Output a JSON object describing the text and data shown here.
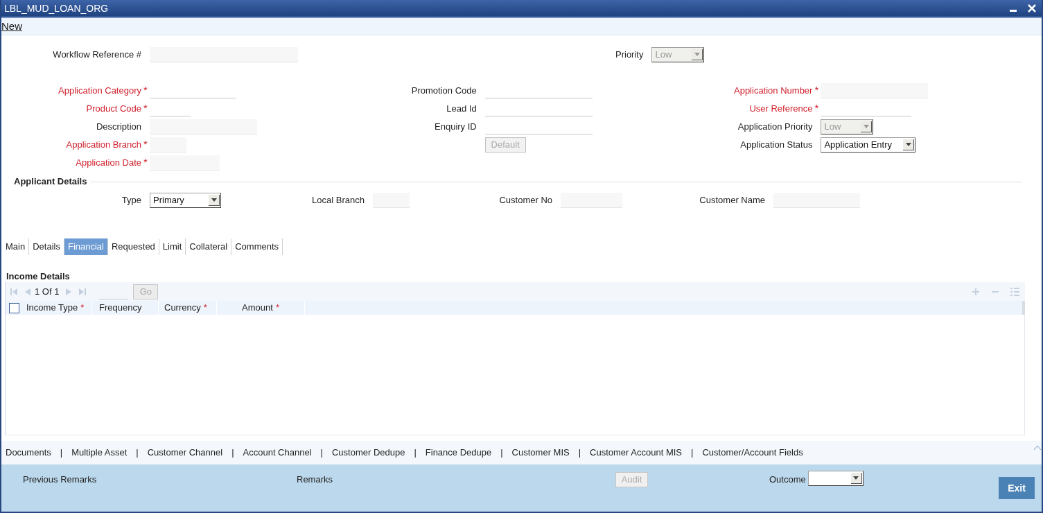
{
  "window": {
    "title": "LBL_MUD_LOAN_ORG"
  },
  "toolbar": {
    "new_link": "New"
  },
  "header": {
    "workflow_reference": {
      "label": "Workflow Reference #",
      "disabled": true
    },
    "priority": {
      "label": "Priority",
      "value": "Low",
      "disabled": true
    }
  },
  "form_columns": [
    [
      {
        "kind": "input",
        "label": "Application Category",
        "required_mark": "*",
        "disabled": false
      },
      {
        "kind": "input",
        "label": "Product Code",
        "required_mark": "*",
        "disabled": false
      },
      {
        "kind": "input",
        "label": "Description",
        "disabled": true
      },
      {
        "kind": "input",
        "label": "Application Branch",
        "required_mark": "*",
        "disabled": true
      },
      {
        "kind": "input",
        "label": "Application Date",
        "required_mark": "*",
        "disabled": true
      }
    ],
    [
      {
        "kind": "input",
        "label": "Promotion Code",
        "disabled": false
      },
      {
        "kind": "input",
        "label": "Lead Id",
        "disabled": false
      },
      {
        "kind": "input",
        "label": "Enquiry ID",
        "disabled": false
      },
      {
        "kind": "button",
        "text": "Default",
        "disabled": true
      }
    ],
    [
      {
        "kind": "input",
        "label": "Application Number",
        "required_mark": "*",
        "disabled": true
      },
      {
        "kind": "input",
        "label": "User Reference",
        "required_mark": "*",
        "disabled": false
      },
      {
        "kind": "select",
        "label": "Application Priority",
        "value": "Low",
        "disabled": true
      },
      {
        "kind": "select",
        "label": "Application Status",
        "value": "Application Entry",
        "disabled": false
      }
    ]
  ],
  "applicant_details": {
    "title": "Applicant Details",
    "fields": [
      {
        "kind": "select",
        "label": "Type",
        "value": "Primary",
        "disabled": false
      },
      {
        "kind": "input",
        "label": "Local Branch",
        "disabled": true
      },
      {
        "kind": "input",
        "label": "Customer No",
        "disabled": true
      },
      {
        "kind": "input",
        "label": "Customer Name",
        "disabled": true
      }
    ]
  },
  "tabs": [
    {
      "label": "Main",
      "selected": false
    },
    {
      "label": "Details",
      "selected": false
    },
    {
      "label": "Financial",
      "selected": true
    },
    {
      "label": "Requested",
      "selected": false
    },
    {
      "label": "Limit",
      "selected": false
    },
    {
      "label": "Collateral",
      "selected": false
    },
    {
      "label": "Comments",
      "selected": false
    }
  ],
  "income_details": {
    "title": "Income Details",
    "pager": "1 Of 1",
    "go_button": "Go",
    "columns": [
      {
        "label": "Income Type",
        "required_mark": "*"
      },
      {
        "label": "Frequency"
      },
      {
        "label": "Currency",
        "required_mark": "*"
      },
      {
        "label": "Amount",
        "required_mark": "*"
      }
    ],
    "select_all_checked": false
  },
  "links": [
    "Documents",
    "Multiple Asset",
    "Customer Channel",
    "Account Channel",
    "Customer Dedupe",
    "Finance Dedupe",
    "Customer MIS",
    "Customer Account MIS",
    "Customer/Account Fields"
  ],
  "link_separator": "|",
  "footer": {
    "previous_remarks": "Previous Remarks",
    "remarks": "Remarks",
    "audit_button": {
      "text": "Audit",
      "disabled": true
    },
    "outcome": {
      "label": "Outcome"
    },
    "exit_button": "Exit"
  }
}
